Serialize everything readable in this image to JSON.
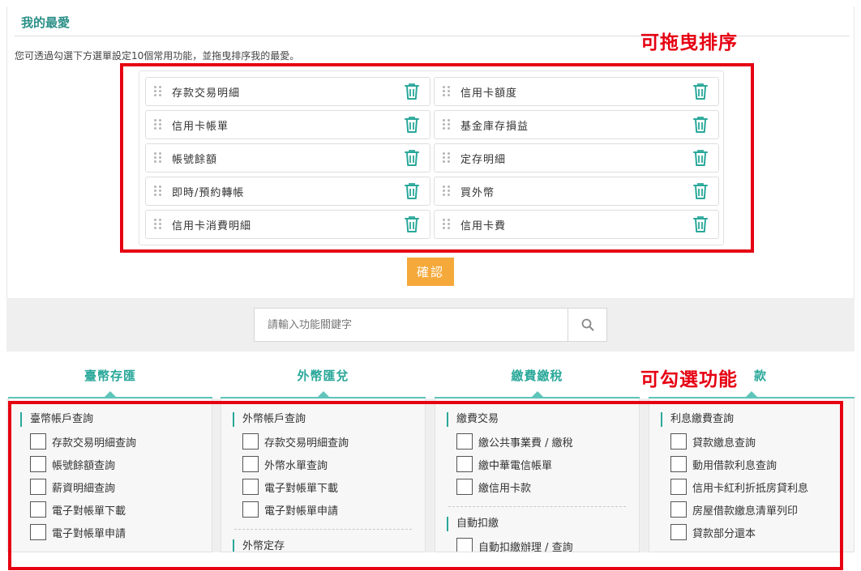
{
  "favorites": {
    "title": "我的最愛",
    "description": "您可透過勾選下方選單設定10個常用功能，並拖曳排序我的最愛。",
    "items_left": [
      "存款交易明細",
      "信用卡帳單",
      "帳號餘額",
      "即時/預約轉帳",
      "信用卡消費明細"
    ],
    "items_right": [
      "信用卡額度",
      "基金庫存損益",
      "定存明細",
      "買外幣",
      "信用卡費"
    ],
    "confirm_label": "確認"
  },
  "annotations": {
    "drag_sort": "可拖曳排序",
    "check_function": "可勾選功能"
  },
  "search": {
    "placeholder": "請輸入功能關鍵字"
  },
  "tabs": [
    "臺幣存匯",
    "外幣匯兌",
    "繳費繳稅",
    "款"
  ],
  "columns": [
    {
      "groups": [
        {
          "title": "臺幣帳戶查詢",
          "items": [
            "存款交易明細查詢",
            "帳號餘額查詢",
            "薪資明細查詢",
            "電子對帳單下載",
            "電子對帳單申請"
          ]
        }
      ]
    },
    {
      "groups": [
        {
          "title": "外幣帳戶查詢",
          "items": [
            "存款交易明細查詢",
            "外幣水單查詢",
            "電子對帳單下載",
            "電子對帳單申請"
          ]
        },
        {
          "title": "外幣定存",
          "items": []
        }
      ]
    },
    {
      "groups": [
        {
          "title": "繳費交易",
          "items": [
            "繳公共事業費 / 繳稅",
            "繳中華電信帳單",
            "繳信用卡款"
          ]
        },
        {
          "title": "自動扣繳",
          "items": [
            "自動扣繳辦理 / 查詢"
          ]
        }
      ]
    },
    {
      "groups": [
        {
          "title": "利息繳費查詢",
          "items": [
            "貸款繳息查詢",
            "動用借款利息查詢",
            "信用卡紅利折抵房貸利息",
            "房屋借款繳息清單列印",
            "貸款部分還本"
          ]
        }
      ]
    }
  ],
  "colors": {
    "accent": "#2aa89a",
    "confirm": "#f5a93a",
    "annotation": "#e60012"
  }
}
